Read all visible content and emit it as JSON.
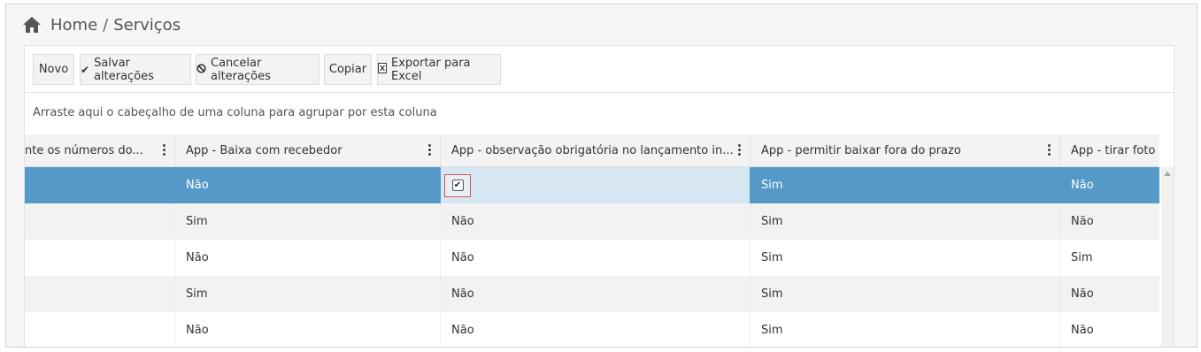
{
  "breadcrumb": {
    "home": "Home",
    "separator": "/",
    "current": "Serviços",
    "icon": "home-icon"
  },
  "toolbar": {
    "buttons": [
      {
        "label": "Novo",
        "icon": ""
      },
      {
        "label": "Salvar alterações",
        "icon": "check-icon"
      },
      {
        "label": "Cancelar alterações",
        "icon": "ban-icon"
      },
      {
        "label": "Copiar",
        "icon": ""
      },
      {
        "label": "Exportar para Excel",
        "icon": "excel-icon"
      }
    ]
  },
  "group_hint": "Arraste aqui o cabeçalho de uma coluna para agrupar por esta coluna",
  "grid": {
    "columns": [
      "nte os números do...",
      "App - Baixa com recebedor",
      "App - observação obrigatória no lançamento in...",
      "App - permitir baixar fora do prazo",
      "App - tirar foto do"
    ],
    "rows": [
      {
        "cells": [
          "",
          "Não",
          "",
          "Sim",
          "Não"
        ],
        "selected": true,
        "checkbox_checked": true
      },
      {
        "cells": [
          "",
          "Sim",
          "Não",
          "Sim",
          "Não"
        ]
      },
      {
        "cells": [
          "",
          "Não",
          "Não",
          "Sim",
          "Sim"
        ]
      },
      {
        "cells": [
          "",
          "Sim",
          "Não",
          "Sim",
          "Não"
        ]
      },
      {
        "cells": [
          "",
          "Não",
          "Não",
          "Sim",
          "Não"
        ]
      }
    ]
  },
  "colors": {
    "selected_row": "#5499c7",
    "editing_cell": "#d6e6f2",
    "checkbox_border": "#d9534f"
  }
}
